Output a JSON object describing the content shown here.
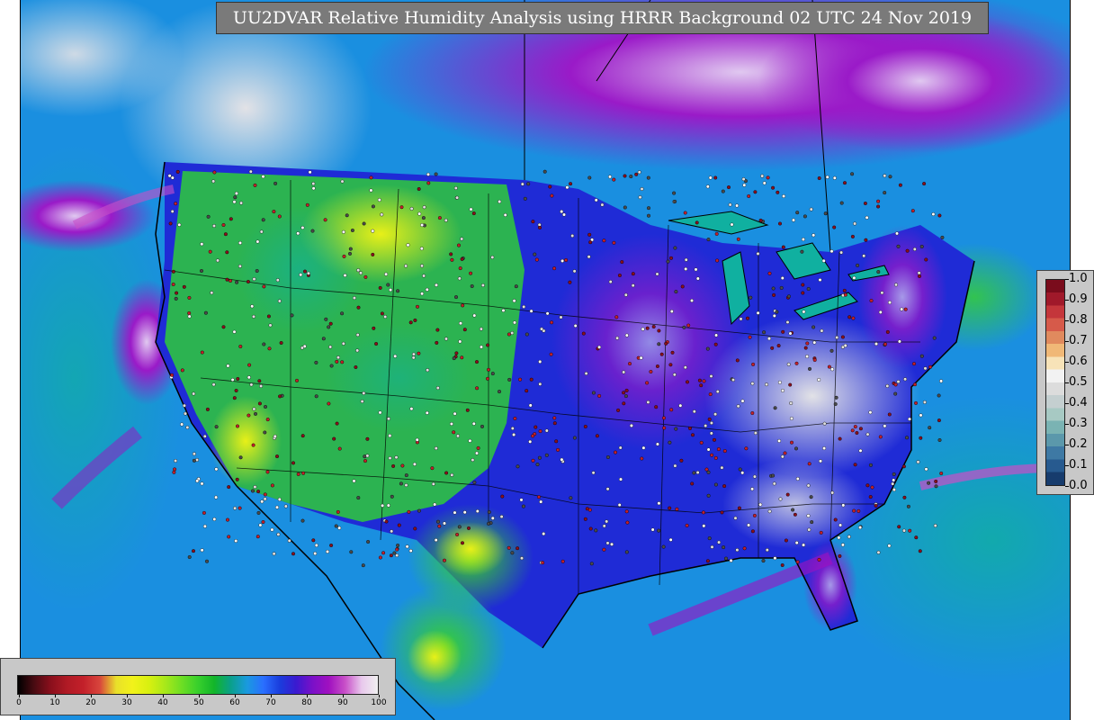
{
  "title": "UU2DVAR Relative Humidity Analysis using HRRR Background 02 UTC 24 Nov 2019",
  "colorbar_right": {
    "label": "",
    "ticks": [
      "1.0",
      "0.9",
      "0.8",
      "0.7",
      "0.6",
      "0.5",
      "0.4",
      "0.3",
      "0.2",
      "0.1",
      "0.0"
    ],
    "colors": [
      "#7a0c1c",
      "#a0192a",
      "#c4363b",
      "#d65a4a",
      "#e08a5e",
      "#f0b877",
      "#f7e3b8",
      "#f2f2f2",
      "#dcdcdc",
      "#c4cfd0",
      "#a7c9c3",
      "#7ab3b3",
      "#5b98ab",
      "#3e79a4",
      "#275a8f",
      "#173c6d"
    ]
  },
  "colorbar_bottom": {
    "ticks": [
      "0",
      "10",
      "20",
      "30",
      "40",
      "50",
      "60",
      "70",
      "80",
      "90",
      "100"
    ],
    "colors": [
      "#000000",
      "#4a0b12",
      "#8a0f1c",
      "#b01a25",
      "#c3202a",
      "#d8453c",
      "#e9e02a",
      "#f2f21a",
      "#d8f010",
      "#a8e81a",
      "#6ede24",
      "#38d02c",
      "#12b52a",
      "#0aa08a",
      "#1a9adf",
      "#2a6fff",
      "#1a3ddd",
      "#3a1ad0",
      "#7a10c8",
      "#a010c0",
      "#c850c8",
      "#e8c8ec",
      "#f0f0f0"
    ]
  },
  "legend_colors": {
    "ocean_blue": "#1a8fe0",
    "dry_green": "#2dcc3a",
    "very_dry_yellow": "#e8e81e",
    "moist_purple": "#7a1ac8",
    "saturated_white": "#dcdcdc",
    "deep_blue": "#1f2bd6"
  }
}
